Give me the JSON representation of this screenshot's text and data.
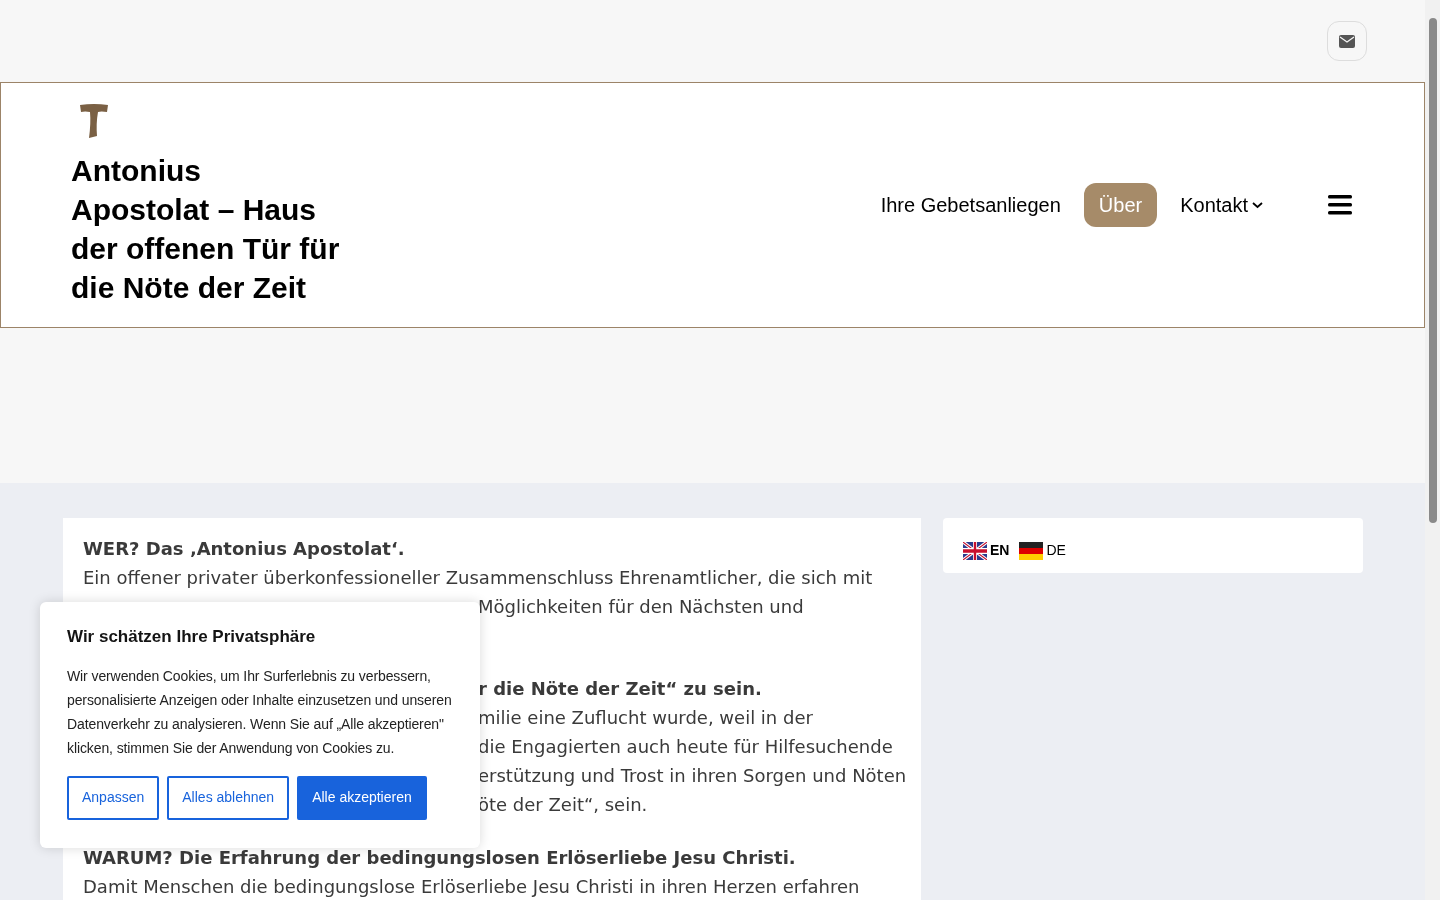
{
  "site_title": "Antonius Apostolat – Haus der offenen Tür für die Nöte der Zeit",
  "nav": [
    {
      "label": "Ihre Gebetsanliegen",
      "selected": false,
      "dropdown": false
    },
    {
      "label": "Über",
      "selected": true,
      "dropdown": false
    },
    {
      "label": "Kontakt",
      "selected": false,
      "dropdown": true
    }
  ],
  "article": [
    {
      "kind": "heading",
      "text": "WER? Das ‚Antonius Apostolat‘."
    },
    {
      "kind": "line",
      "text": "Ein offener privater überkonfessioneller Zusammenschluss Ehrenamtlicher, die sich mit"
    },
    {
      "kind": "fragment",
      "text": "Möglichkeiten für den Nächsten und"
    },
    {
      "kind": "hidden"
    },
    {
      "kind": "gap"
    },
    {
      "kind": "heading-fragment",
      "text": "r die Nöte der Zeit“ zu sein."
    },
    {
      "kind": "fragment",
      "text": "milie eine Zuflucht wurde, weil in der"
    },
    {
      "kind": "fragment",
      "text": "die Engagierten auch heute für Hilfesuchende"
    },
    {
      "kind": "fragment",
      "text": "erstützung und Trost in ihren Sorgen und Nöten"
    },
    {
      "kind": "fragment",
      "text": "öte der Zeit“, sein."
    },
    {
      "kind": "gap"
    },
    {
      "kind": "heading",
      "text": "WARUM? Die Erfahrung der bedingungslosen Erlöserliebe Jesu Christi."
    },
    {
      "kind": "line",
      "text": "Damit Menschen die bedingungslose Erlöserliebe Jesu Christi in ihren Herzen erfahren"
    }
  ],
  "languages": [
    {
      "code": "EN",
      "selected": true
    },
    {
      "code": "DE",
      "selected": false
    }
  ],
  "cookie_banner": {
    "title": "Wir schätzen Ihre Privatsphäre",
    "text": "Wir verwenden Cookies, um Ihr Surferlebnis zu verbessern, personalisierte Anzeigen oder Inhalte einzusetzen und unseren Datenverkehr zu analysieren. Wenn Sie auf „Alle akzeptieren\" klicken, stimmen Sie der Anwendung von Cookies zu.",
    "buttons": [
      {
        "label": "Anpassen",
        "primary": false
      },
      {
        "label": "Alles ablehnen",
        "primary": false
      },
      {
        "label": "Alle akzeptieren",
        "primary": true
      }
    ]
  }
}
